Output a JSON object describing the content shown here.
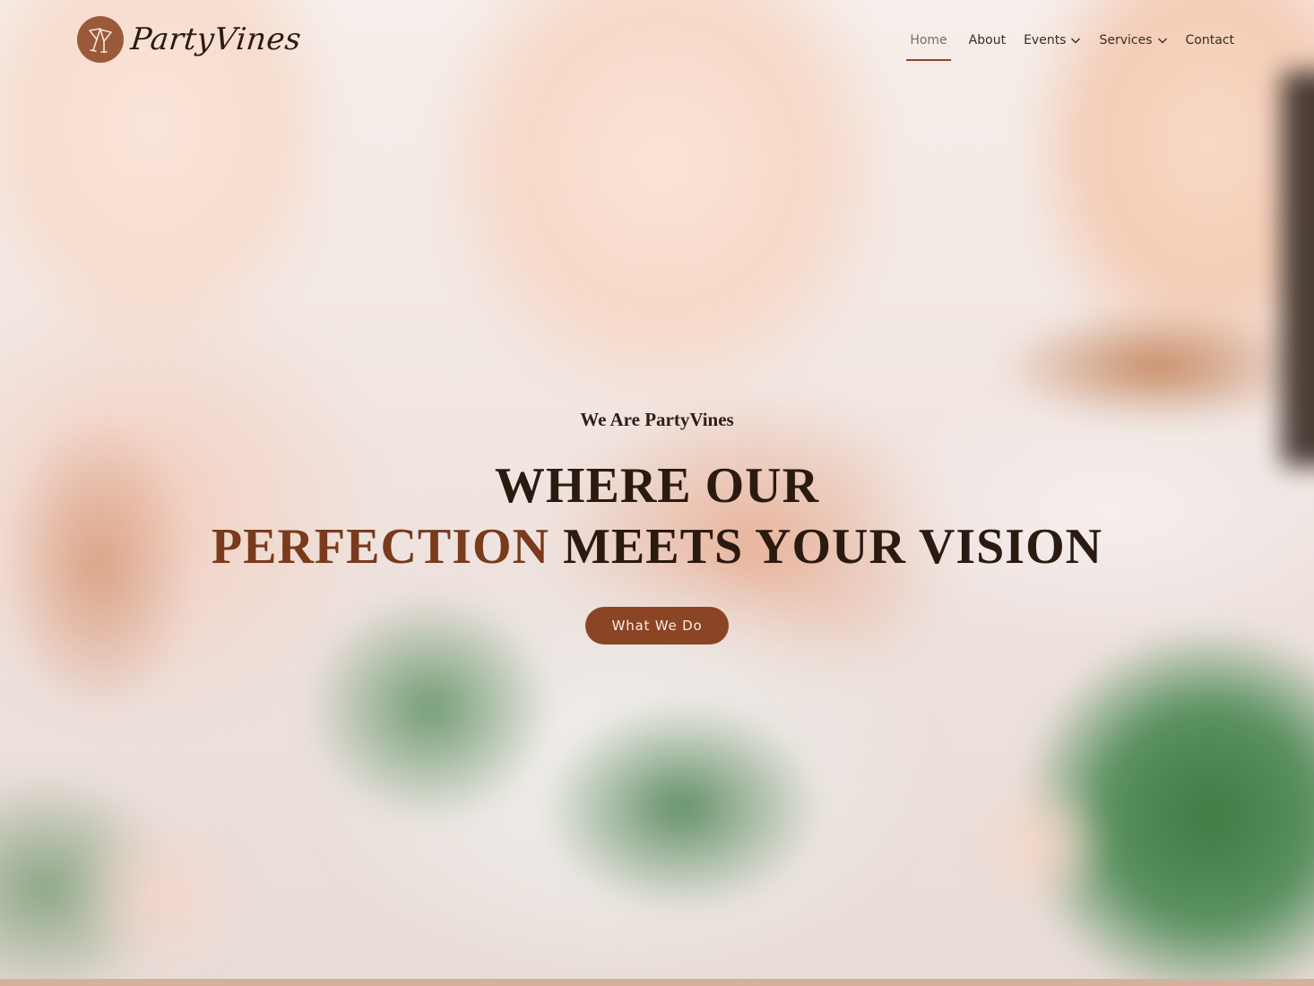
{
  "brand": {
    "name": "PartyVines",
    "logo_icon": "cocktail-glasses-icon",
    "accent_color": "#8b4424"
  },
  "nav": {
    "items": [
      {
        "label": "Home",
        "active": true,
        "has_dropdown": false
      },
      {
        "label": "About",
        "active": false,
        "has_dropdown": false
      },
      {
        "label": "Events",
        "active": false,
        "has_dropdown": true
      },
      {
        "label": "Services",
        "active": false,
        "has_dropdown": true
      },
      {
        "label": "Contact",
        "active": false,
        "has_dropdown": false
      }
    ]
  },
  "hero": {
    "eyebrow": "We Are PartyVines",
    "headline_line1": "WHERE OUR",
    "headline_accent": "PERFECTION",
    "headline_rest": " MEETS YOUR VISION",
    "cta_label": "What We Do"
  }
}
